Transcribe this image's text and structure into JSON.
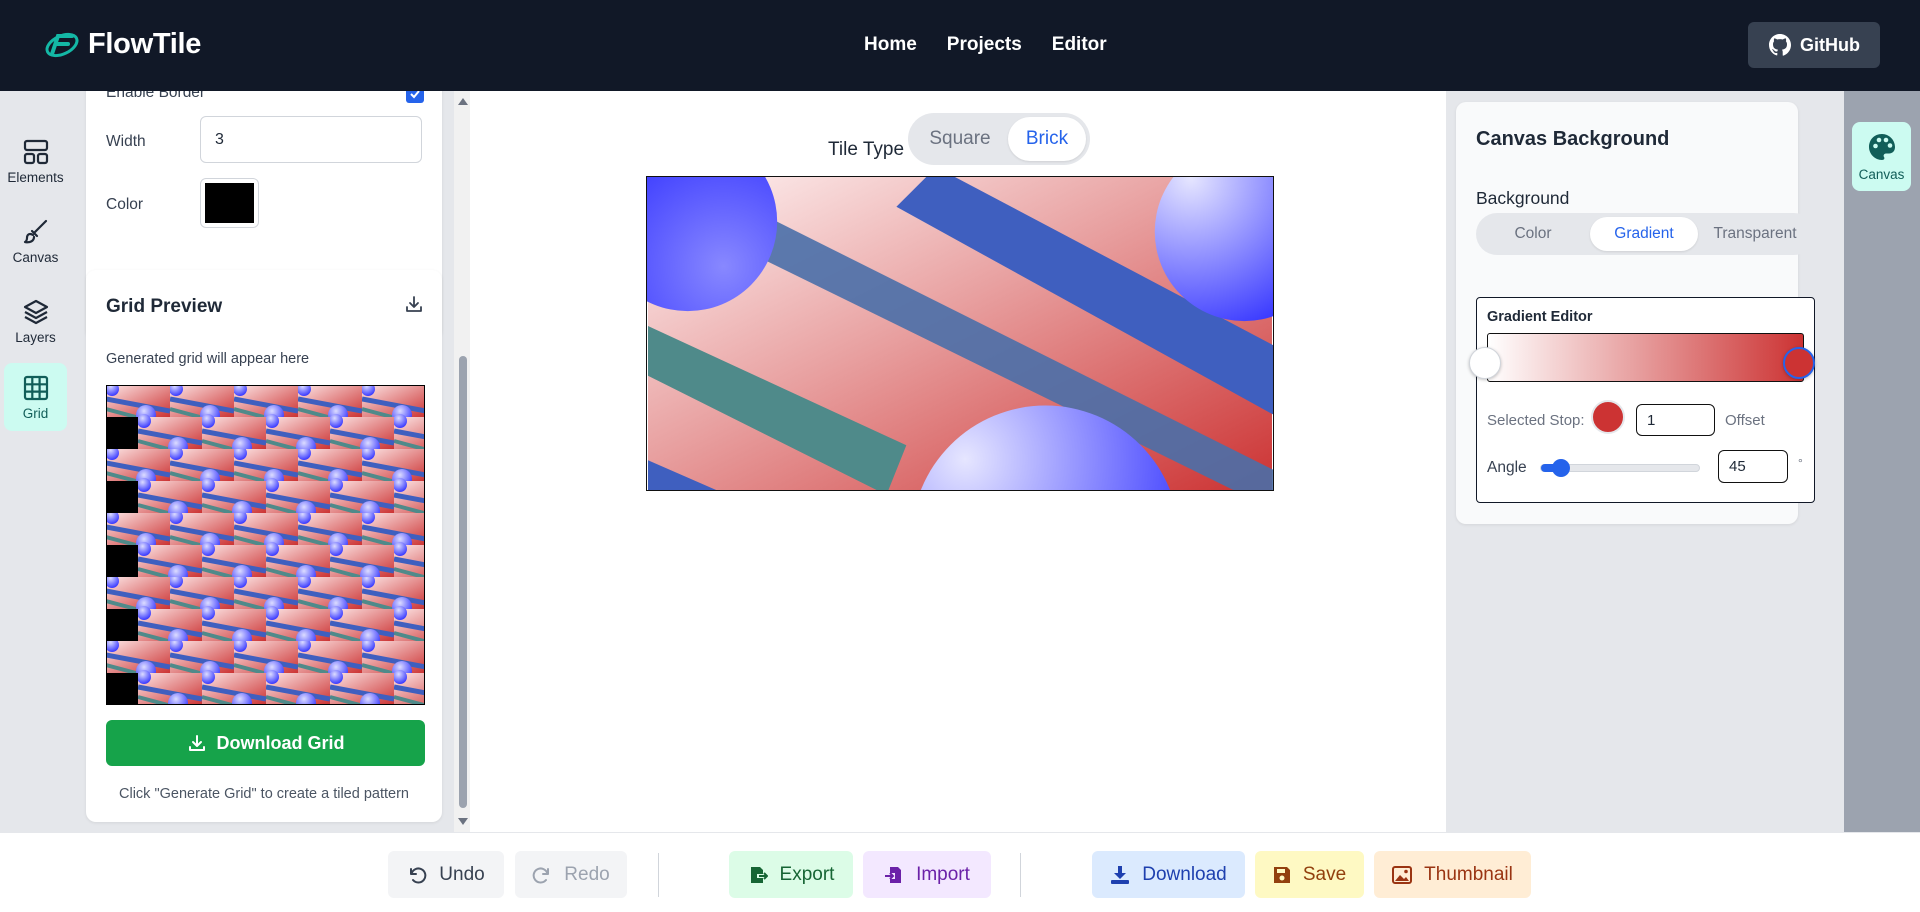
{
  "header": {
    "brand": "FlowTile",
    "nav": [
      "Home",
      "Projects",
      "Editor"
    ],
    "github": "GitHub"
  },
  "left_rail": {
    "items": [
      {
        "label": "Elements",
        "icon": "layout-icon"
      },
      {
        "label": "Canvas",
        "icon": "brush-icon"
      },
      {
        "label": "Layers",
        "icon": "layers-icon"
      },
      {
        "label": "Grid",
        "icon": "grid-icon",
        "active": true
      }
    ]
  },
  "border_settings": {
    "enable_label": "Enable Border",
    "enabled": true,
    "width_label": "Width",
    "width_value": "3",
    "color_label": "Color",
    "color_value": "#000000"
  },
  "grid_preview": {
    "title": "Grid Preview",
    "placeholder": "Generated grid will appear here",
    "download_label": "Download Grid",
    "hint": "Click \"Generate Grid\" to create a tiled pattern"
  },
  "tile": {
    "type_label": "Tile Type",
    "options": [
      "Square",
      "Brick"
    ],
    "selected": "Brick"
  },
  "canvas_background": {
    "title": "Canvas Background",
    "section_label": "Background",
    "modes": [
      "Color",
      "Gradient",
      "Transparent"
    ],
    "selected_mode": "Gradient",
    "gradient_editor": {
      "title": "Gradient Editor",
      "stops": [
        {
          "offset": 0,
          "color": "#ffffff"
        },
        {
          "offset": 1,
          "color": "#cc3333"
        }
      ],
      "selected_stop_label": "Selected Stop:",
      "selected_stop_color": "#cc3333",
      "offset_value": "1",
      "offset_label": "Offset",
      "angle_label": "Angle",
      "angle_value": "45",
      "angle_unit": "°",
      "angle_fraction": 0.125
    }
  },
  "right_rail": {
    "item": {
      "label": "Canvas",
      "icon": "palette-icon"
    }
  },
  "footer": {
    "undo": "Undo",
    "redo": "Redo",
    "export": "Export",
    "import": "Import",
    "download": "Download",
    "save": "Save",
    "thumbnail": "Thumbnail"
  },
  "colors": {
    "accent": "#2563eb",
    "header_bg": "#111827",
    "success": "#16a34a",
    "teal": "#115e59"
  }
}
